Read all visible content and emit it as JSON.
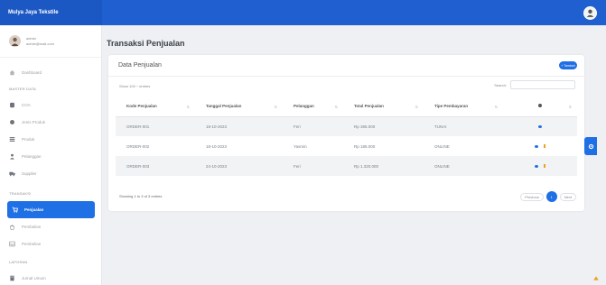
{
  "app": {
    "brand": "Mulya Jaya Tekstile"
  },
  "colors": {
    "primary": "#1f6fe5",
    "topbar": "#1f5fcf",
    "edit": "#f0a020"
  },
  "profile": {
    "name": "admin",
    "email": "admin@mail.com"
  },
  "sidebar": {
    "items_top": [
      {
        "label": "Dashboard",
        "icon": "home-icon"
      }
    ],
    "master_heading": "MASTER DATA",
    "master_items": [
      {
        "label": "COA",
        "icon": "database-icon"
      },
      {
        "label": "Jenis Produk",
        "icon": "tag-icon"
      },
      {
        "label": "Produk",
        "icon": "list-icon"
      },
      {
        "label": "Pelanggan",
        "icon": "users-icon"
      },
      {
        "label": "Supplier",
        "icon": "truck-icon"
      }
    ],
    "transaksi_heading": "TRANSAKSI",
    "transaksi_items": [
      {
        "label": "Penjualan",
        "icon": "cart-icon"
      },
      {
        "label": "Pembelian",
        "icon": "bag-icon"
      },
      {
        "label": "Pembelian",
        "icon": "inbox-icon"
      }
    ],
    "laporan_heading": "LAPORAN",
    "laporan_items": [
      {
        "label": "Jurnal Umum",
        "icon": "book-icon"
      }
    ]
  },
  "page": {
    "title": "Transaksi Penjualan"
  },
  "card": {
    "title": "Data Penjualan",
    "add_label": "+ Tambah",
    "show_entries": "Show  100  ÷  entries",
    "search_label": "Search:",
    "search_value": "",
    "info": "Showing 1 to 3 of 3 entries",
    "prev_label": "Previous",
    "page_number": "1",
    "next_label": "Next"
  },
  "table": {
    "headers": [
      "Kode Penjualan",
      "Tanggal Penjualan",
      "Pelanggan",
      "Total Penjualan",
      "Tipe Pembayaran"
    ],
    "rows": [
      {
        "kode": "ORDER-001",
        "tanggal": "18-10-2023",
        "pelanggan": "Feri",
        "total": "Rp 385.000",
        "tipe": "TUNAI"
      },
      {
        "kode": "ORDER-002",
        "tanggal": "18-10-2023",
        "pelanggan": "Yasmin",
        "total": "Rp 185.000",
        "tipe": "ONLINE"
      },
      {
        "kode": "ORDER-003",
        "tanggal": "24-10-2023",
        "pelanggan": "Feri",
        "total": "Rp 1.320.000",
        "tipe": "ONLINE"
      }
    ]
  }
}
